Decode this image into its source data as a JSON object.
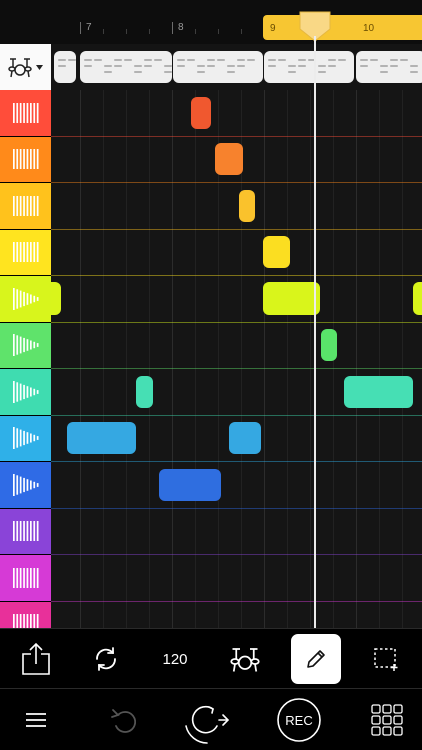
{
  "timeline": {
    "bars": [
      "7",
      "8",
      "9",
      "10"
    ],
    "loop_label_start": "9",
    "loop_label_end": "10",
    "loop_color": "#f7c632"
  },
  "tracks": [
    {
      "color": "#ff4d3a",
      "glyph": "bars"
    },
    {
      "color": "#ff8a1a",
      "glyph": "bars"
    },
    {
      "color": "#ffc21c",
      "glyph": "bars"
    },
    {
      "color": "#ffe41f",
      "glyph": "bars"
    },
    {
      "color": "#d8f51c",
      "glyph": "triangle"
    },
    {
      "color": "#5fe36b",
      "glyph": "triangle"
    },
    {
      "color": "#3fdcb0",
      "glyph": "triangle"
    },
    {
      "color": "#2fb0e8",
      "glyph": "triangle"
    },
    {
      "color": "#2f6be6",
      "glyph": "triangle"
    },
    {
      "color": "#8a44d8",
      "glyph": "bars"
    },
    {
      "color": "#d63ad6",
      "glyph": "bars"
    },
    {
      "color": "#e8309a",
      "glyph": "bars"
    }
  ],
  "notes": [
    {
      "track": 0,
      "color": "#f0582f"
    },
    {
      "track": 1,
      "color": "#f7822d"
    },
    {
      "track": 2,
      "color": "#fac22c"
    },
    {
      "track": 3,
      "color": "#fbde21"
    },
    {
      "track": 4,
      "color": "#d9f51b"
    },
    {
      "track": 4,
      "color": "#d9f51b"
    },
    {
      "track": 4,
      "color": "#d9f51b"
    },
    {
      "track": 5,
      "color": "#59e36a"
    },
    {
      "track": 6,
      "color": "#46dfb4"
    },
    {
      "track": 6,
      "color": "#46dfb4"
    },
    {
      "track": 7,
      "color": "#35a8e2"
    },
    {
      "track": 7,
      "color": "#35a8e2"
    },
    {
      "track": 8,
      "color": "#2f6ee0"
    }
  ],
  "toolbar": {
    "share_icon": "share-icon",
    "loop_icon": "loop-icon",
    "tempo": "120",
    "kit_icon": "drum-kit-icon",
    "pencil_icon": "pencil-icon",
    "select_icon": "marquee-select-icon"
  },
  "bottom_bar": {
    "menu_icon": "hamburger-menu-icon",
    "undo_icon": "undo-icon",
    "play_icon": "play-redo-icon",
    "record_label": "REC",
    "grid_icon": "grid-icon"
  }
}
